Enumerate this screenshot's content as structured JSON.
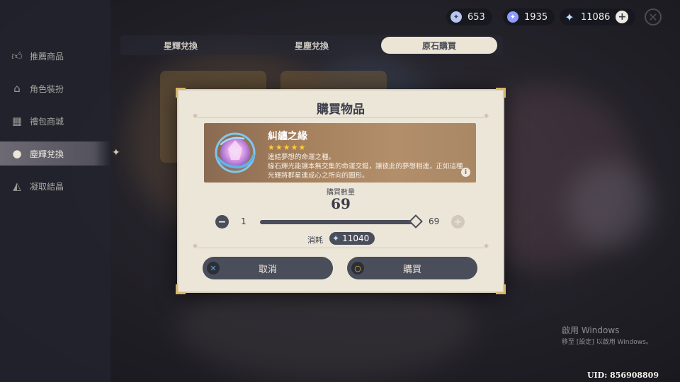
{
  "sidebar": {
    "items": [
      {
        "label": "推薦商品",
        "icon": "thumbs-up-icon",
        "active": false
      },
      {
        "label": "角色裝扮",
        "icon": "hanger-icon",
        "active": false
      },
      {
        "label": "禮包商城",
        "icon": "gift-icon",
        "active": false
      },
      {
        "label": "塵輝兌換",
        "icon": "bag-icon",
        "active": true
      },
      {
        "label": "凝取結晶",
        "icon": "crystal-icon",
        "active": false
      }
    ]
  },
  "currency": {
    "items": [
      {
        "name": "masterless-stardust",
        "value": "653",
        "color": "#b9c6ef"
      },
      {
        "name": "masterless-starglitter",
        "value": "1935",
        "color": "#8e9cff"
      },
      {
        "name": "primogem",
        "value": "11086",
        "color": "#bfe1ff"
      }
    ],
    "plus_symbol": "+",
    "close_symbol": "✕"
  },
  "tabs": [
    {
      "label": "星輝兌換",
      "active": false
    },
    {
      "label": "星塵兌換",
      "active": false
    },
    {
      "label": "原石購買",
      "active": true
    }
  ],
  "modal": {
    "title": "購買物品",
    "item": {
      "name": "糾纏之緣",
      "stars": "★★★★★",
      "star_count": 5,
      "description": "連結夢想的命運之種。\n緣石輝光能讓本無交集的命運交錯，讓彼此的夢想相連，正如這種光輝將群星連成心之所向的圖形。",
      "info_symbol": "i"
    },
    "quantity_label": "購買數量",
    "quantity": "69",
    "min": "1",
    "max": "69",
    "slider_fraction": 1.0,
    "minus_symbol": "−",
    "plus_symbol": "+",
    "cost_label": "消耗",
    "cost_value": "11040",
    "cancel_label": "取消",
    "confirm_label": "購買",
    "cancel_icon": "✕",
    "confirm_icon": "○"
  },
  "watermark": {
    "line1": "啟用 Windows",
    "line2": "移至 [設定] 以啟用 Windows。"
  },
  "uid": "UID: 856908809"
}
